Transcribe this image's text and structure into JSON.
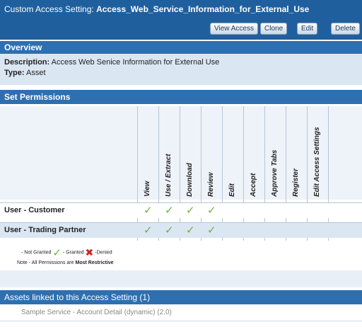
{
  "header": {
    "title_prefix": "Custom Access Setting:",
    "title_name": "Access_Web_Service_Information_for_External_Use",
    "buttons": [
      "View Access",
      "Clone",
      "Edit",
      "Delete"
    ]
  },
  "overview": {
    "heading": "Overview",
    "description_label": "Description:",
    "description_value": "Access Web Senice Information for External Use",
    "type_label": "Type:",
    "type_value": "Asset"
  },
  "permissions": {
    "heading": "Set Permissions",
    "columns": [
      "View",
      "Use / Extract",
      "Download",
      "Review",
      "Edit",
      "Accept",
      "Approve Tabs",
      "Register",
      "Edit Access Settings"
    ],
    "rows": [
      {
        "label": "User - Customer",
        "granted": [
          true,
          true,
          true,
          true,
          false,
          false,
          false,
          false,
          false
        ]
      },
      {
        "label": "User - Trading Partner",
        "granted": [
          true,
          true,
          true,
          true,
          false,
          false,
          false,
          false,
          false
        ]
      }
    ]
  },
  "legend": {
    "not_granted": "- Not Granted",
    "granted": "- Granted",
    "denied": "-Denied",
    "note_prefix": "Note - All Permissions are",
    "note_bold": "Most Restrictive"
  },
  "assets": {
    "heading": "Assets linked to this Access Setting (1)",
    "items": [
      "Sample Service - Account Detail (dynamic) (2.0)"
    ]
  },
  "colors": {
    "header": "#1f5f9e",
    "section": "#2e6fb0",
    "granted": "#6bb33a",
    "denied": "#d12020"
  }
}
